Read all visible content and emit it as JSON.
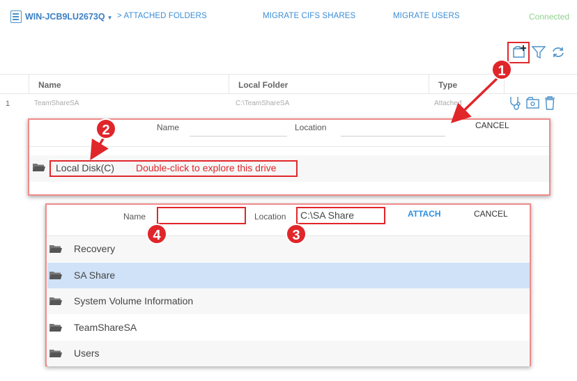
{
  "nav": {
    "server": "WIN-JCB9LU2673Q",
    "attached_folders": "> ATTACHED FOLDERS",
    "migrate_cifs": "MIGRATE CIFS SHARES",
    "migrate_users": "MIGRATE USERS",
    "status": "Connected"
  },
  "table": {
    "headers": [
      "Name",
      "Local Folder",
      "Type"
    ],
    "rows": [
      {
        "num": "1",
        "name": "TeamShareSA",
        "folder": "C:\\TeamShareSA",
        "type": "Attached"
      }
    ]
  },
  "panel1": {
    "name_label": "Name",
    "location_label": "Location",
    "cancel": "CANCEL",
    "drive": "Local Disk(C)",
    "hint": "Double-click to explore this drive"
  },
  "panel2": {
    "name_label": "Name",
    "name_value": "",
    "location_label": "Location",
    "location_value": "C:\\SA Share",
    "attach": "ATTACH",
    "cancel": "CANCEL",
    "folders": [
      "Recovery",
      "SA Share",
      "System Volume Information",
      "TeamShareSA",
      "Users"
    ],
    "selected_index": 1
  },
  "badges": [
    "1",
    "2",
    "3",
    "4"
  ],
  "colors": {
    "accent": "#3b8ed6",
    "callout": "#e0262a",
    "selected_row": "#cfe2f7",
    "status": "#8fd18f"
  }
}
